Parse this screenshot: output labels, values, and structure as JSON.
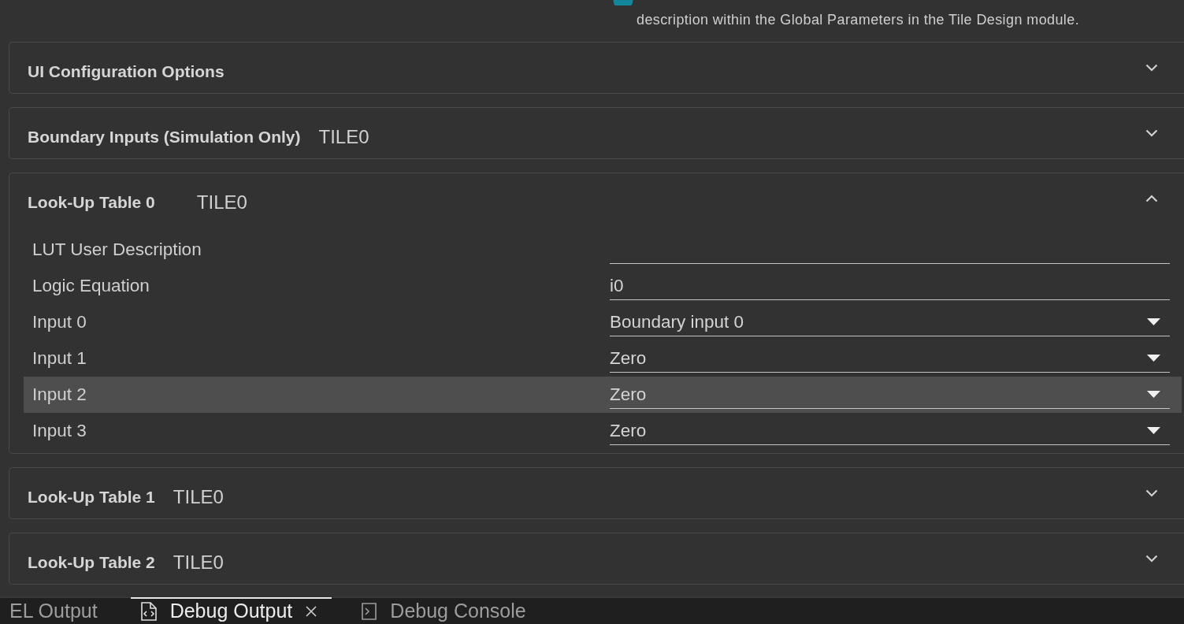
{
  "note": {
    "text": "description within the Global Parameters in the Tile Design module."
  },
  "sections": [
    {
      "title": "UI Configuration Options",
      "expanded": false
    },
    {
      "title": "Boundary Inputs (Simulation Only)",
      "tile": "TILE0",
      "expanded": false
    },
    {
      "title": "Look-Up Table 0",
      "tile": "TILE0",
      "expanded": true,
      "fields": [
        {
          "label": "LUT User Description",
          "kind": "text",
          "highlighted": false
        },
        {
          "label": "Logic Equation",
          "kind": "text",
          "value": "i0",
          "highlighted": false
        },
        {
          "label": "Input 0",
          "kind": "select",
          "value": "Boundary input 0",
          "highlighted": false
        },
        {
          "label": "Input 1",
          "kind": "select",
          "value": "Zero",
          "highlighted": false
        },
        {
          "label": "Input 2",
          "kind": "select",
          "value": "Zero",
          "highlighted": true
        },
        {
          "label": "Input 3",
          "kind": "select",
          "value": "Zero",
          "highlighted": false
        }
      ]
    },
    {
      "title": "Look-Up Table 1",
      "tile": "TILE0",
      "expanded": false
    },
    {
      "title": "Look-Up Table 2",
      "tile": "TILE0",
      "expanded": false
    }
  ],
  "panel_tabs": [
    {
      "label": "EL Output",
      "kind": "plain",
      "selected": false
    },
    {
      "label": "Debug Output",
      "kind": "output",
      "selected": true
    },
    {
      "label": "Debug Console",
      "kind": "console",
      "selected": false
    }
  ]
}
